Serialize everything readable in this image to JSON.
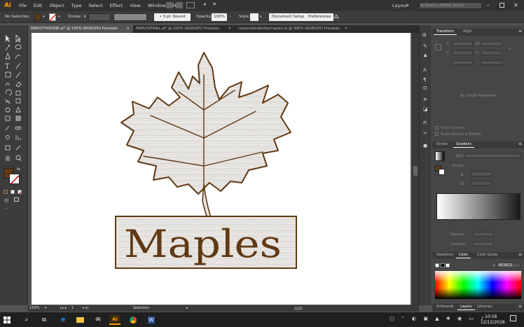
{
  "app": {
    "logo": "Ai"
  },
  "menu": [
    "File",
    "Edit",
    "Object",
    "Type",
    "Select",
    "Effect",
    "View",
    "Window",
    "Help"
  ],
  "top_right": {
    "workspace": "Layout",
    "search_placeholder": "Search Adobe Stock"
  },
  "control_bar": {
    "selection_label": "No Selection",
    "stroke_label": "Stroke:",
    "brush_label": "3 pt. Round",
    "opacity_label": "Opacity:",
    "opacity_value": "100%",
    "style_label": "Style:",
    "document_setup": "Document Setup",
    "preferences": "Preferences"
  },
  "tabs": [
    {
      "label": "MAPLETHISONE.ai* @ 150% (RGB/GPU Preview)",
      "close": "×"
    },
    {
      "label": "MAPLESFINAL.ai* @ 100% (RGB/GPU Preview)",
      "close": "×"
    },
    {
      "label": "corporateidentitymaples.ai @ 300% (RGB/GPU Preview)",
      "close": "×"
    }
  ],
  "artwork": {
    "logo_text": "Maples"
  },
  "status": {
    "zoom": "150%",
    "artboard": "1",
    "tool": "Selection"
  },
  "transform_panel": {
    "tabs": [
      "Transform",
      "Align"
    ],
    "labels": {
      "x": "X:",
      "y": "Y:",
      "w": "W:",
      "h": "H:"
    },
    "empty_text": "No Shape Properties",
    "options": [
      "Scale Corners",
      "Scale Strokes & Effects"
    ]
  },
  "gradient_panel": {
    "tabs": [
      "Stroke",
      "Gradient"
    ],
    "type_label": "Type:",
    "stroke_label": "Stroke:",
    "opacity_label": "Opacity:",
    "location_label": "Location:"
  },
  "color_panel": {
    "tabs": [
      "Swatches",
      "Color",
      "Color Guide"
    ],
    "hex_prefix": "#",
    "hex": "603813"
  },
  "layers_tabs": [
    "Artboards",
    "Layers",
    "Libraries"
  ],
  "taskbar": {
    "time": "10:58",
    "date": "12/12/2018",
    "app_icons": [
      "windows-icon",
      "search-icon",
      "task-view-icon",
      "edge-icon",
      "file-explorer-icon",
      "mail-icon",
      "illustrator-icon",
      "chrome-icon",
      "word-icon"
    ]
  },
  "colors": {
    "fill": "#603813",
    "accent": "#ff9a00",
    "brown": "#603813"
  }
}
